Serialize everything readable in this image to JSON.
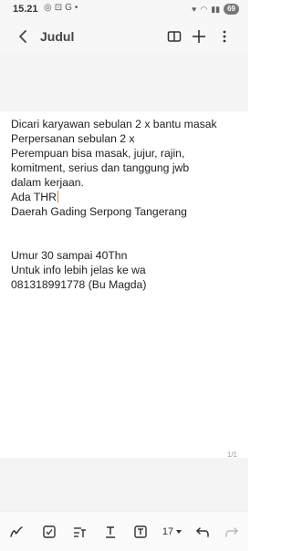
{
  "status_bar": {
    "time": "15.21",
    "battery": "69"
  },
  "app_bar": {
    "title": "Judul"
  },
  "note": {
    "lines": [
      "Dicari karyawan sebulan 2 x bantu masak",
      "Perpersanan sebulan 2 x",
      "Perempuan bisa masak, jujur, rajin,",
      "komitment, serius dan tanggung jwb",
      "dalam kerjaan.",
      "Ada THR",
      "Daerah Gading Serpong Tangerang",
      "Umur 30 sampai 40Thn",
      "Untuk info lebih jelas ke wa",
      "081318991778 (Bu Magda)"
    ],
    "page_indicator": "1/1"
  },
  "toolbar": {
    "font_size": "17"
  }
}
